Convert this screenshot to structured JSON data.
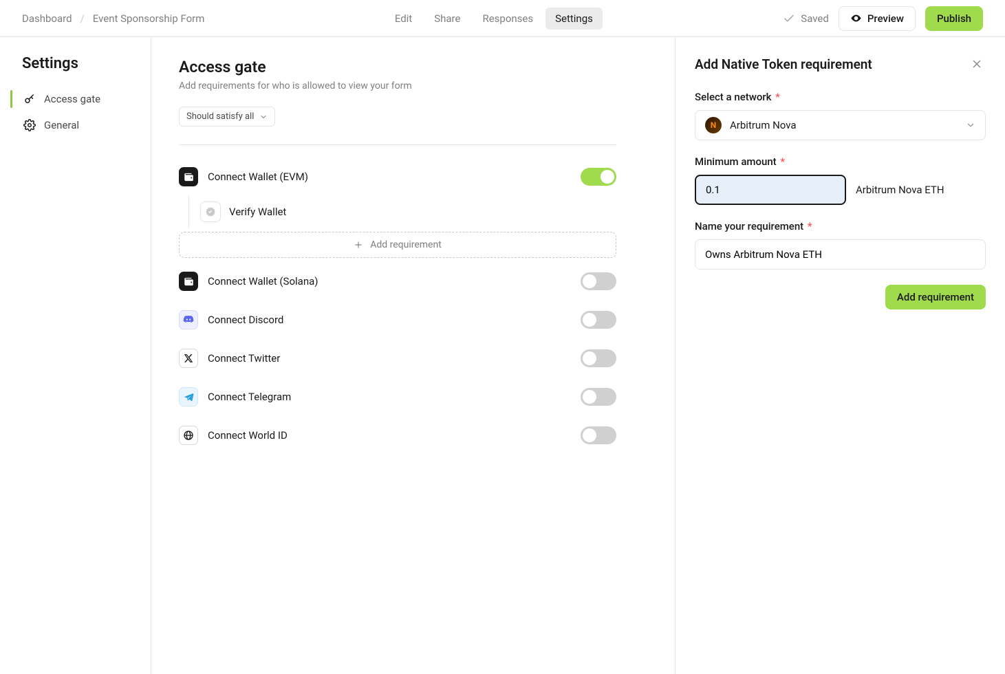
{
  "breadcrumb": {
    "dashboard": "Dashboard",
    "formName": "Event Sponsorship Form"
  },
  "tabs": {
    "edit": "Edit",
    "share": "Share",
    "responses": "Responses",
    "settings": "Settings"
  },
  "topRight": {
    "savedLabel": "Saved",
    "preview": "Preview",
    "publish": "Publish"
  },
  "sidebar": {
    "title": "Settings",
    "items": [
      {
        "id": "access-gate",
        "label": "Access gate",
        "icon": "key",
        "active": true
      },
      {
        "id": "general",
        "label": "General",
        "icon": "gear",
        "active": false
      }
    ]
  },
  "page": {
    "title": "Access gate",
    "subtitle": "Add requirements for who is allowed to view your form"
  },
  "satisfy": {
    "label": "Should satisfy all"
  },
  "gates": [
    {
      "id": "wallet-evm",
      "label": "Connect Wallet (EVM)",
      "icon": "wallet",
      "on": true
    },
    {
      "id": "wallet-solana",
      "label": "Connect Wallet (Solana)",
      "icon": "wallet",
      "on": false
    },
    {
      "id": "discord",
      "label": "Connect Discord",
      "icon": "discord",
      "on": false
    },
    {
      "id": "twitter",
      "label": "Connect Twitter",
      "icon": "x",
      "on": false
    },
    {
      "id": "telegram",
      "label": "Connect Telegram",
      "icon": "telegram",
      "on": false
    },
    {
      "id": "worldid",
      "label": "Connect World ID",
      "icon": "world",
      "on": false
    }
  ],
  "walletSub": {
    "verifyLabel": "Verify Wallet",
    "addRequirement": "Add requirement"
  },
  "rightPanel": {
    "title": "Add Native Token requirement",
    "networkLabel": "Select a network",
    "networkValue": "Arbitrum Nova",
    "amountLabel": "Minimum amount",
    "amountValue": "0.1",
    "amountUnit": "Arbitrum Nova ETH",
    "nameLabel": "Name your requirement",
    "nameValue": "Owns Arbitrum Nova ETH",
    "submit": "Add requirement"
  }
}
